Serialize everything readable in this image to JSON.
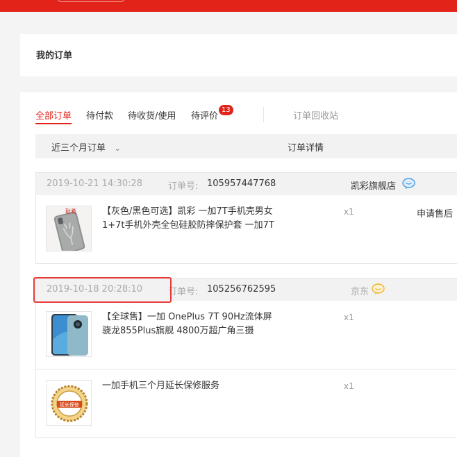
{
  "page": {
    "title": "我的订单"
  },
  "tabs": [
    {
      "label": "全部订单",
      "active": true
    },
    {
      "label": "待付款",
      "active": false
    },
    {
      "label": "待收货/使用",
      "active": false
    },
    {
      "label": "待评价",
      "active": false,
      "badge": "13"
    }
  ],
  "recycle_bin": "订单回收站",
  "filter": {
    "time_range": "近三个月订单",
    "detail_header": "订单详情"
  },
  "orders": [
    {
      "time": "2019-10-21 14:30:28",
      "order_no_label": "订单号:",
      "order_no": "105957447768",
      "shop": "凯彩旗舰店",
      "items": [
        {
          "name": "【灰色/黑色可选】凯彩 一加7T手机壳男女1+7t手机外壳全包硅胶防摔保护套 一加7T",
          "qty": "x1",
          "action": "申请售后"
        }
      ]
    },
    {
      "time": "2019-10-18 20:28:10",
      "order_no_label": "订单号:",
      "order_no": "105256762595",
      "shop": "京东",
      "items": [
        {
          "name": "【全球售】一加 OnePlus 7T 90Hz流体屏 骁龙855Plus旗舰 4800万超广角三摄",
          "qty": "x1"
        },
        {
          "name": "一加手机三个月延长保修服务",
          "qty": "x1"
        }
      ]
    }
  ],
  "thumb_text": {
    "case_brand": "耿希",
    "warranty_seal": "延长保修"
  },
  "colors": {
    "brand_red": "#e2231a",
    "chat_blue": "#4a9fe0",
    "chat_yellow": "#f0b429",
    "highlight": "#e53935"
  }
}
